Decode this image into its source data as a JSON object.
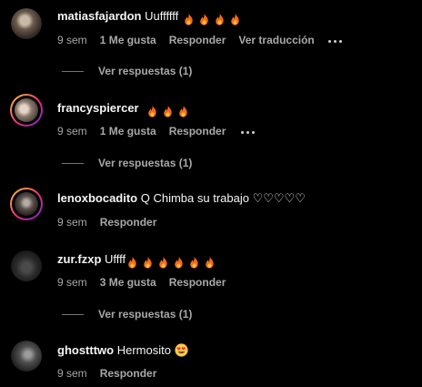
{
  "comments": [
    {
      "username": "matiasfajardon",
      "text": "Uuffffff",
      "fire_count": 4,
      "time": "9 sem",
      "likes": "1 Me gusta",
      "reply_label": "Responder",
      "translate_label": "Ver traducción",
      "replies_label": "Ver respuestas (1)"
    },
    {
      "username": "francyspiercer",
      "text": "",
      "fire_count": 3,
      "time": "9 sem",
      "likes": "1 Me gusta",
      "reply_label": "Responder",
      "replies_label": "Ver respuestas (1)"
    },
    {
      "username": "lenoxbocadito",
      "text": "Q Chimba su trabajo ♡♡♡♡♡",
      "time": "9 sem",
      "reply_label": "Responder"
    },
    {
      "username": "zur.fzxp",
      "text": "Uffff",
      "fire_count": 6,
      "time": "9 sem",
      "likes": "3 Me gusta",
      "reply_label": "Responder",
      "replies_label": "Ver respuestas (1)"
    },
    {
      "username": "ghostttwo",
      "text": "Hermosito",
      "time": "9 sem",
      "reply_label": "Responder"
    }
  ],
  "icons": {
    "fire": "fire-emoji-icon",
    "heart_eyes": "heart-eyes-emoji-icon",
    "more": "more-options-icon"
  },
  "colors": {
    "background": "#000000",
    "text": "#f5f5f5",
    "secondary": "#a8a8a8",
    "fire": "#f4691b"
  }
}
